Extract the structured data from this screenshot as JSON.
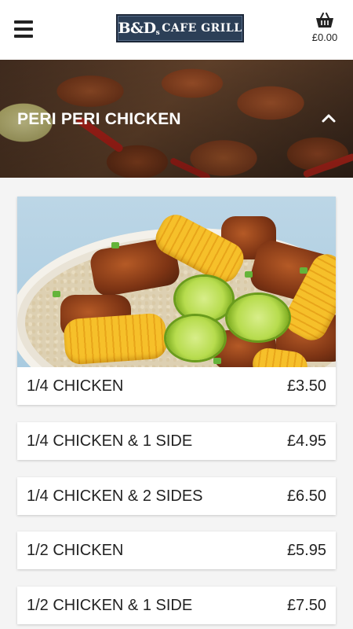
{
  "header": {
    "logo_text_bd": "B&D",
    "logo_text_s": "s",
    "logo_text_grill": "CAFE GRILL",
    "basket_total": "£0.00"
  },
  "section": {
    "title": "PERI PERI CHICKEN"
  },
  "featured_item": {
    "name": "1/4 CHICKEN",
    "price": "£3.50"
  },
  "items": [
    {
      "name": "1/4 CHICKEN & 1 SIDE",
      "price": "£4.95"
    },
    {
      "name": "1/4 CHICKEN & 2 SIDES",
      "price": "£6.50"
    },
    {
      "name": "1/2 CHICKEN",
      "price": "£5.95"
    },
    {
      "name": "1/2 CHICKEN & 1 SIDE",
      "price": "£7.50"
    }
  ],
  "colors": {
    "header_bg": "#ffffff",
    "page_bg": "#f4f4f4",
    "logo_bg": "#2c3f57",
    "text": "#222222"
  },
  "icons": {
    "menu": "hamburger-menu-icon",
    "basket": "basket-icon",
    "collapse": "chevron-up-icon"
  }
}
